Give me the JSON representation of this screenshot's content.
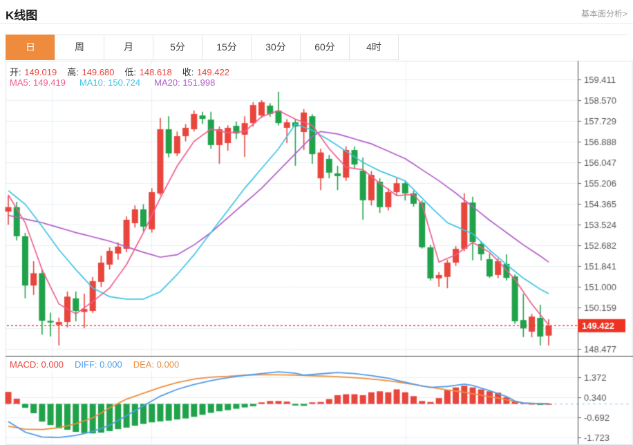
{
  "header": {
    "title": "K线图",
    "link": "基本面分析>"
  },
  "tabs": {
    "items": [
      "日",
      "周",
      "月",
      "5分",
      "15分",
      "30分",
      "60分",
      "4时"
    ],
    "selected_index": 0
  },
  "legend": {
    "ohlc": [
      {
        "label": "开:",
        "value": "149.019"
      },
      {
        "label": "高:",
        "value": "149.680"
      },
      {
        "label": "低:",
        "value": "148.618"
      },
      {
        "label": "收:",
        "value": "149.422"
      }
    ],
    "ma": [
      {
        "label": "MA5:",
        "value": "149.419",
        "color": "#ee5e8e"
      },
      {
        "label": "MA10:",
        "value": "150.724",
        "color": "#3fc4e4"
      },
      {
        "label": "MA20:",
        "value": "151.998",
        "color": "#b25dc8"
      }
    ],
    "macd": [
      {
        "label": "MACD:",
        "value": "0.000",
        "color": "#e8453c"
      },
      {
        "label": "DIFF:",
        "value": "0.000",
        "color": "#4f9de8"
      },
      {
        "label": "DEA:",
        "value": "0.000",
        "color": "#ef8c3a"
      }
    ]
  },
  "colors": {
    "up": "#e8453c",
    "down": "#20a24b",
    "ma5": "#ee5e8e",
    "ma10": "#3fc4e4",
    "ma20": "#b25dc8",
    "diff": "#4f9de8",
    "dea": "#ef8c3a",
    "price_line": "#ef3323",
    "tab_active": "#ef8b3d",
    "grid": "#e9eff5",
    "frame": "#dfe3e8",
    "axis": "#444444",
    "tick_text": "#555555",
    "zero_line": "#aed9f2"
  },
  "chart_data": [
    {
      "type": "candlestick",
      "title": "K线图",
      "legend_position": "top-left",
      "grid": true,
      "y_tick_top": 159.411,
      "y_tick_step": 0.841,
      "y_ticks": [
        159.411,
        158.57,
        157.729,
        156.888,
        156.047,
        155.206,
        154.365,
        153.524,
        152.682,
        151.841,
        151.0,
        150.159,
        148.477
      ],
      "hidden_tick": 149.318,
      "current_price": 149.422,
      "current_price_label": "149.422",
      "candles_ohlc": [
        [
          154.05,
          154.7,
          153.52,
          154.23
        ],
        [
          154.23,
          154.45,
          152.88,
          153.05
        ],
        [
          153.05,
          153.19,
          150.53,
          151.05
        ],
        [
          151.05,
          152.04,
          150.67,
          151.55
        ],
        [
          151.55,
          151.7,
          149.05,
          149.62
        ],
        [
          149.62,
          149.95,
          148.98,
          149.55
        ],
        [
          149.46,
          149.75,
          148.62,
          149.57
        ],
        [
          149.57,
          150.81,
          149.35,
          150.6
        ],
        [
          150.53,
          150.81,
          149.6,
          150.02
        ],
        [
          149.98,
          150.72,
          149.32,
          150.1
        ],
        [
          150.02,
          151.4,
          149.94,
          151.23
        ],
        [
          151.2,
          152.26,
          151.0,
          151.98
        ],
        [
          151.9,
          152.6,
          151.7,
          152.46
        ],
        [
          152.35,
          152.8,
          152.1,
          152.63
        ],
        [
          152.54,
          153.85,
          152.4,
          153.72
        ],
        [
          153.58,
          154.3,
          153.4,
          154.14
        ],
        [
          154.14,
          154.35,
          153.25,
          153.44
        ],
        [
          153.33,
          155.0,
          153.2,
          154.84
        ],
        [
          154.78,
          157.85,
          154.7,
          157.39
        ],
        [
          157.39,
          157.92,
          156.25,
          156.41
        ],
        [
          156.41,
          157.3,
          156.3,
          157.11
        ],
        [
          157.11,
          157.6,
          156.9,
          157.45
        ],
        [
          157.39,
          158.15,
          157.3,
          158.01
        ],
        [
          157.95,
          158.1,
          157.6,
          157.81
        ],
        [
          157.78,
          158.1,
          156.6,
          156.75
        ],
        [
          156.75,
          157.5,
          155.99,
          157.39
        ],
        [
          156.83,
          157.55,
          156.52,
          157.45
        ],
        [
          157.53,
          157.7,
          157.0,
          157.22
        ],
        [
          157.17,
          157.92,
          156.27,
          157.64
        ],
        [
          157.64,
          158.49,
          157.5,
          158.37
        ],
        [
          157.95,
          158.57,
          157.85,
          158.49
        ],
        [
          158.35,
          158.45,
          157.9,
          158.01
        ],
        [
          158.15,
          158.91,
          157.55,
          157.64
        ],
        [
          157.45,
          157.8,
          156.83,
          157.67
        ],
        [
          157.67,
          157.8,
          155.91,
          157.5
        ],
        [
          157.28,
          158.21,
          156.55,
          158.07
        ],
        [
          157.92,
          158.0,
          155.99,
          156.38
        ],
        [
          155.4,
          156.6,
          154.92,
          156.45
        ],
        [
          156.19,
          156.35,
          155.4,
          155.63
        ],
        [
          155.6,
          155.91,
          154.92,
          155.49
        ],
        [
          155.43,
          156.69,
          155.3,
          156.55
        ],
        [
          156.55,
          156.69,
          155.8,
          155.96
        ],
        [
          155.71,
          156.24,
          153.72,
          154.51
        ],
        [
          154.51,
          155.7,
          154.3,
          155.54
        ],
        [
          155.26,
          155.4,
          154.0,
          154.23
        ],
        [
          154.23,
          155.0,
          154.1,
          154.84
        ],
        [
          154.84,
          155.4,
          154.7,
          155.2
        ],
        [
          155.2,
          155.3,
          154.5,
          154.79
        ],
        [
          154.79,
          154.9,
          154.25,
          154.37
        ],
        [
          154.42,
          154.5,
          152.55,
          152.6
        ],
        [
          152.6,
          152.7,
          151.25,
          151.34
        ],
        [
          151.34,
          151.6,
          151.0,
          151.48
        ],
        [
          151.4,
          152.1,
          150.94,
          151.98
        ],
        [
          151.98,
          152.65,
          151.85,
          152.54
        ],
        [
          152.54,
          154.79,
          152.45,
          154.42
        ],
        [
          154.42,
          154.65,
          152.07,
          152.82
        ],
        [
          152.74,
          152.85,
          152.07,
          152.32
        ],
        [
          152.12,
          152.35,
          151.36,
          151.42
        ],
        [
          151.48,
          152.15,
          151.35,
          152.04
        ],
        [
          151.93,
          152.32,
          151.25,
          151.36
        ],
        [
          151.42,
          151.5,
          149.5,
          149.6
        ],
        [
          149.65,
          150.72,
          148.96,
          149.31
        ],
        [
          149.18,
          149.9,
          148.95,
          149.79
        ],
        [
          149.74,
          150.27,
          148.62,
          148.98
        ],
        [
          149.019,
          149.68,
          148.618,
          149.422
        ]
      ],
      "ma5_keypoints": [
        [
          0,
          154.73
        ],
        [
          2,
          153.6
        ],
        [
          4,
          151.7
        ],
        [
          6,
          150.3
        ],
        [
          8,
          149.9
        ],
        [
          10,
          150.4
        ],
        [
          12,
          150.95
        ],
        [
          14,
          151.9
        ],
        [
          16,
          153.2
        ],
        [
          18,
          154.6
        ],
        [
          20,
          155.9
        ],
        [
          22,
          156.9
        ],
        [
          24,
          157.4
        ],
        [
          26,
          157.25
        ],
        [
          28,
          157.3
        ],
        [
          30,
          157.9
        ],
        [
          32,
          158.15
        ],
        [
          34,
          157.8
        ],
        [
          36,
          157.55
        ],
        [
          38,
          156.6
        ],
        [
          40,
          155.85
        ],
        [
          42,
          155.75
        ],
        [
          44,
          155.2
        ],
        [
          46,
          154.7
        ],
        [
          48,
          154.75
        ],
        [
          49,
          154.35
        ],
        [
          51,
          152.0
        ],
        [
          53,
          152.3
        ],
        [
          55,
          152.8
        ],
        [
          57,
          152.4
        ],
        [
          58,
          152.05
        ],
        [
          60,
          151.3
        ],
        [
          62,
          150.3
        ],
        [
          64,
          149.45
        ]
      ],
      "ma10_keypoints": [
        [
          0,
          154.9
        ],
        [
          2,
          154.35
        ],
        [
          4,
          153.45
        ],
        [
          6,
          152.5
        ],
        [
          8,
          151.7
        ],
        [
          10,
          150.95
        ],
        [
          12,
          150.6
        ],
        [
          14,
          150.5
        ],
        [
          16,
          150.5
        ],
        [
          18,
          150.8
        ],
        [
          20,
          151.5
        ],
        [
          22,
          152.3
        ],
        [
          24,
          153.2
        ],
        [
          26,
          154.1
        ],
        [
          28,
          155.0
        ],
        [
          30,
          155.8
        ],
        [
          32,
          156.6
        ],
        [
          34,
          157.6
        ],
        [
          36,
          157.35
        ],
        [
          38,
          156.95
        ],
        [
          40,
          156.5
        ],
        [
          42,
          156.05
        ],
        [
          44,
          155.7
        ],
        [
          47,
          155.3
        ],
        [
          49,
          154.6
        ],
        [
          50,
          154.25
        ],
        [
          52,
          153.6
        ],
        [
          54,
          153.3
        ],
        [
          55,
          153.15
        ],
        [
          57,
          152.5
        ],
        [
          59,
          151.9
        ],
        [
          61,
          151.35
        ],
        [
          63,
          150.9
        ],
        [
          64,
          150.72
        ]
      ],
      "ma20_keypoints": [
        [
          0,
          153.9
        ],
        [
          4,
          153.6
        ],
        [
          8,
          153.2
        ],
        [
          12,
          152.85
        ],
        [
          16,
          152.4
        ],
        [
          18,
          152.2
        ],
        [
          20,
          152.3
        ],
        [
          22,
          152.7
        ],
        [
          24,
          153.2
        ],
        [
          26,
          153.8
        ],
        [
          28,
          154.4
        ],
        [
          30,
          155.0
        ],
        [
          32,
          155.7
        ],
        [
          34,
          156.4
        ],
        [
          36,
          157.1
        ],
        [
          37,
          157.3
        ],
        [
          39,
          157.2
        ],
        [
          41,
          157.0
        ],
        [
          43,
          156.8
        ],
        [
          45,
          156.5
        ],
        [
          47,
          156.2
        ],
        [
          49,
          155.75
        ],
        [
          51,
          155.3
        ],
        [
          53,
          154.8
        ],
        [
          55,
          154.25
        ],
        [
          57,
          153.7
        ],
        [
          59,
          153.2
        ],
        [
          61,
          152.7
        ],
        [
          63,
          152.25
        ],
        [
          64,
          152.0
        ]
      ]
    },
    {
      "type": "macd",
      "y_ticks": [
        1.372,
        0.34,
        -0.692,
        -1.723
      ],
      "zero_level": 0,
      "histogram": [
        0.62,
        0.27,
        -0.2,
        -0.48,
        -0.91,
        -1.09,
        -1.26,
        -1.33,
        -1.44,
        -1.5,
        -1.52,
        -1.48,
        -1.4,
        -1.3,
        -1.22,
        -1.12,
        -1.03,
        -0.95,
        -0.9,
        -0.86,
        -0.8,
        -0.75,
        -0.66,
        -0.56,
        -0.46,
        -0.38,
        -0.32,
        -0.25,
        -0.18,
        -0.12,
        0.08,
        0.15,
        0.15,
        0.12,
        -0.08,
        -0.1,
        0.08,
        0.1,
        0.25,
        0.45,
        0.5,
        0.5,
        0.45,
        0.6,
        0.65,
        0.6,
        0.75,
        0.6,
        0.4,
        0.15,
        0.1,
        0.3,
        0.7,
        0.85,
        0.94,
        0.85,
        0.75,
        0.65,
        0.58,
        0.35,
        0.15,
        0.05,
        0.02,
        -0.03,
        0.01
      ],
      "diff_keypoints": [
        [
          0,
          -0.91
        ],
        [
          2,
          -1.45
        ],
        [
          4,
          -1.7
        ],
        [
          6,
          -1.73
        ],
        [
          8,
          -1.62
        ],
        [
          10,
          -1.42
        ],
        [
          12,
          -1.1
        ],
        [
          14,
          -0.6
        ],
        [
          16,
          -0.1
        ],
        [
          17,
          0.15
        ],
        [
          18,
          0.4
        ],
        [
          20,
          0.75
        ],
        [
          22,
          1.0
        ],
        [
          24,
          1.2
        ],
        [
          26,
          1.35
        ],
        [
          28,
          1.47
        ],
        [
          30,
          1.56
        ],
        [
          32,
          1.65
        ],
        [
          34,
          1.58
        ],
        [
          35,
          1.48
        ],
        [
          37,
          1.55
        ],
        [
          39,
          1.62
        ],
        [
          41,
          1.56
        ],
        [
          43,
          1.46
        ],
        [
          45,
          1.32
        ],
        [
          47,
          1.12
        ],
        [
          49,
          0.92
        ],
        [
          50,
          0.85
        ],
        [
          52,
          0.9
        ],
        [
          54,
          1.02
        ],
        [
          55,
          0.95
        ],
        [
          57,
          0.68
        ],
        [
          59,
          0.38
        ],
        [
          60,
          0.15
        ],
        [
          61,
          0.05
        ],
        [
          63,
          0.01
        ],
        [
          64,
          0.01
        ]
      ],
      "dea_keypoints": [
        [
          0,
          -1.15
        ],
        [
          2,
          -1.3
        ],
        [
          4,
          -1.32
        ],
        [
          6,
          -1.22
        ],
        [
          8,
          -1.02
        ],
        [
          10,
          -0.72
        ],
        [
          12,
          -0.2
        ],
        [
          14,
          0.25
        ],
        [
          16,
          0.55
        ],
        [
          18,
          0.85
        ],
        [
          20,
          1.1
        ],
        [
          22,
          1.28
        ],
        [
          24,
          1.38
        ],
        [
          26,
          1.42
        ],
        [
          28,
          1.48
        ],
        [
          30,
          1.5
        ],
        [
          32,
          1.5
        ],
        [
          34,
          1.48
        ],
        [
          36,
          1.45
        ],
        [
          38,
          1.42
        ],
        [
          40,
          1.38
        ],
        [
          42,
          1.32
        ],
        [
          44,
          1.24
        ],
        [
          46,
          1.14
        ],
        [
          48,
          1.0
        ],
        [
          50,
          0.86
        ],
        [
          52,
          0.72
        ],
        [
          54,
          0.6
        ],
        [
          56,
          0.45
        ],
        [
          58,
          0.3
        ],
        [
          60,
          0.12
        ],
        [
          61,
          0.04
        ],
        [
          63,
          0.01
        ],
        [
          64,
          0.01
        ]
      ]
    }
  ]
}
